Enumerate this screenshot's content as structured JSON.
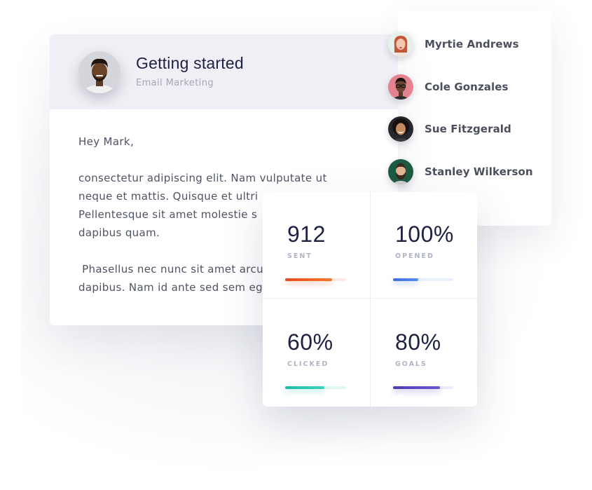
{
  "email": {
    "title": "Getting started",
    "subtitle": "Email Marketing",
    "greeting": "Hey Mark,",
    "paragraph1": "consectetur adipiscing elit. Nam vulputate ut neque et mattis. Quisque et ultri\nPellentesque sit amet molestie s\ndapibus quam.",
    "paragraph2": " Phasellus nec nunc sit amet arcu\ndapibus. Nam id ante sed sem eg"
  },
  "contacts": [
    {
      "name": "Myrtie Andrews",
      "avatar": "woman-red-hair-avatar",
      "bg": "#e9f3ee"
    },
    {
      "name": "Cole Gonzales",
      "avatar": "man-glasses-avatar",
      "bg": "#e57f8a"
    },
    {
      "name": "Sue Fitzgerald",
      "avatar": "woman-curly-hair-avatar",
      "bg": "#2a2a30"
    },
    {
      "name": "Stanley Wilkerson",
      "avatar": "man-beard-avatar",
      "bg": "#1f5b46"
    }
  ],
  "stats": [
    {
      "value": "912",
      "label": "SENT",
      "progress": 0.78,
      "color": "#e84c1e",
      "color2": "#f7762c",
      "track": "#fde9e2"
    },
    {
      "value": "100%",
      "label": "OPENED",
      "progress": 0.42,
      "color": "#3b6fe0",
      "color2": "#5b8cf0",
      "track": "#e8f0fd"
    },
    {
      "value": "60%",
      "label": "CLICKED",
      "progress": 0.65,
      "color": "#1fb9a6",
      "color2": "#3fd2bd",
      "track": "#dff6f3"
    },
    {
      "value": "80%",
      "label": "GOALS",
      "progress": 0.78,
      "color": "#4e3cb8",
      "color2": "#6a57d2",
      "track": "#eceafb"
    }
  ]
}
